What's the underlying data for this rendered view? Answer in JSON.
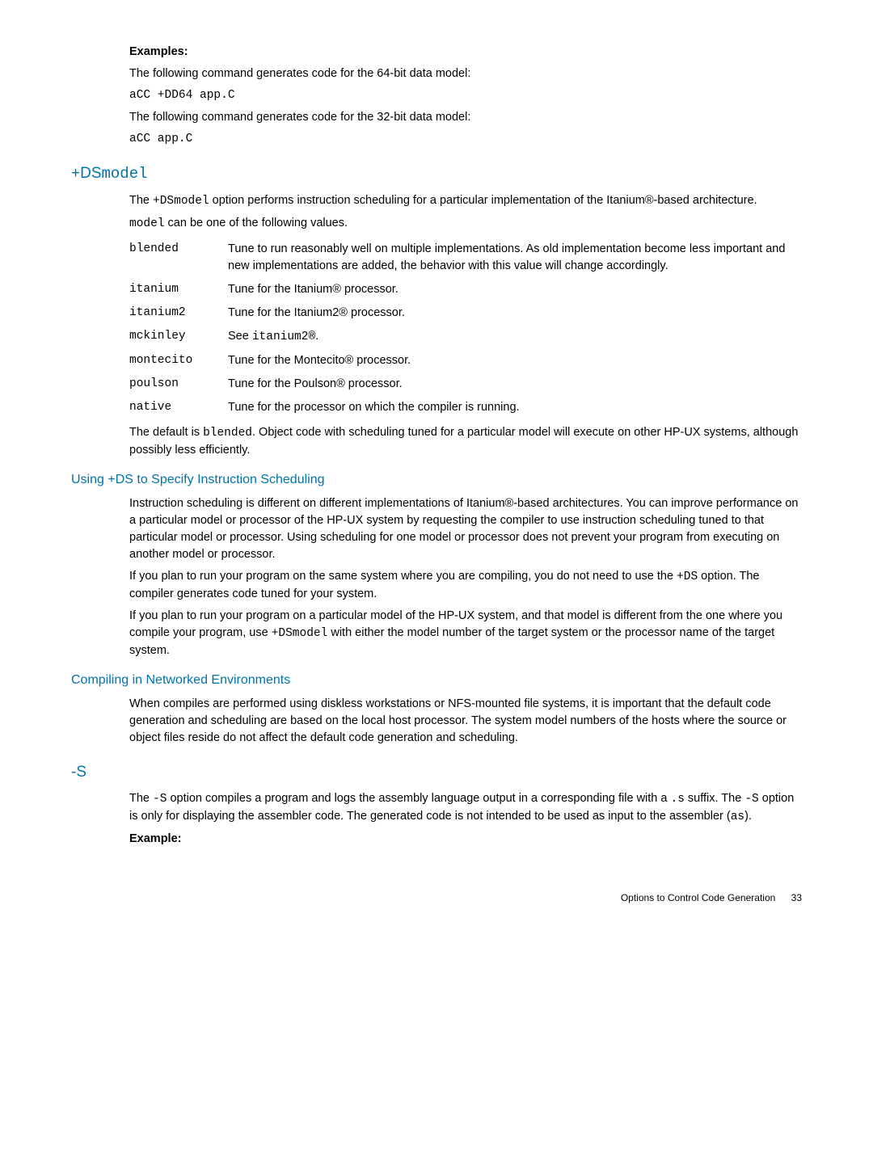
{
  "examples": {
    "heading": "Examples:",
    "line1": "The following command generates code for the 64-bit data model:",
    "code1": "aCC +DD64 app.C",
    "line2": "The following command generates code for the 32-bit data model:",
    "code2": "aCC app.C"
  },
  "dsmodel": {
    "heading_prefix": "+DS",
    "heading_mono": "model",
    "intro_prefix": "The ",
    "intro_code": "+DSmodel",
    "intro_rest": " option performs instruction scheduling for a particular implementation of the Itanium®-based architecture.",
    "model_intro_code": "model",
    "model_intro_rest": " can be one of the following values.",
    "rows": {
      "blended": {
        "term": "blended",
        "desc": "Tune to run reasonably well on multiple implementations. As old implementation become less important and new implementations are added, the behavior with this value will change accordingly."
      },
      "itanium": {
        "term": "itanium",
        "desc": "Tune for the Itanium® processor."
      },
      "itanium2": {
        "term": "itanium2",
        "desc": "Tune for the Itanium2® processor."
      },
      "mckinley": {
        "term": "mckinley",
        "desc_prefix": "See ",
        "desc_code": "itanium2®",
        "desc_suffix": "."
      },
      "montecito": {
        "term": "montecito",
        "desc": "Tune for the Montecito® processor."
      },
      "poulson": {
        "term": "poulson",
        "desc": "Tune for the Poulson® processor."
      },
      "native": {
        "term": "native",
        "desc": "Tune for the processor on which the compiler is running."
      }
    },
    "default_prefix": "The default is ",
    "default_code": "blended",
    "default_rest": ". Object code with scheduling tuned for a particular model will execute on other HP-UX systems, although possibly less efficiently."
  },
  "using_ds": {
    "heading": "Using +DS to Specify Instruction Scheduling",
    "p1": "Instruction scheduling is different on different implementations of Itanium®-based architectures. You can improve performance on a particular model or processor of the HP-UX system by requesting the compiler to use instruction scheduling tuned to that particular model or processor. Using scheduling for one model or processor does not prevent your program from executing on another model or processor.",
    "p2_prefix": "If you plan to run your program on the same system where you are compiling, you do not need to use the ",
    "p2_code": "+DS",
    "p2_rest": " option. The compiler generates code tuned for your system.",
    "p3_prefix": "If you plan to run your program on a particular model of the HP-UX system, and that model is different from the one where you compile your program, use ",
    "p3_code": "+DSmodel",
    "p3_rest": " with either the model number of the target system or the processor name of the target system."
  },
  "networked": {
    "heading": "Compiling in Networked Environments",
    "p1": "When compiles are performed using diskless workstations or NFS-mounted file systems, it is important that the default code generation and scheduling are based on the local host processor. The system model numbers of the hosts where the source or object files reside do not affect the default code generation and scheduling."
  },
  "s_option": {
    "heading": "-S",
    "p1_prefix": "The ",
    "p1_code1": "-S",
    "p1_mid1": " option compiles a program and logs the assembly language output in a corresponding file with a ",
    "p1_code2": ".s",
    "p1_mid2": " suffix. The ",
    "p1_code3": "-S",
    "p1_mid3": " option is only for displaying the assembler code. The generated code is not intended to be used as input to the assembler (",
    "p1_code4": "as",
    "p1_suffix": ").",
    "example_heading": "Example:"
  },
  "footer": {
    "text": "Options to Control Code Generation",
    "page": "33"
  }
}
